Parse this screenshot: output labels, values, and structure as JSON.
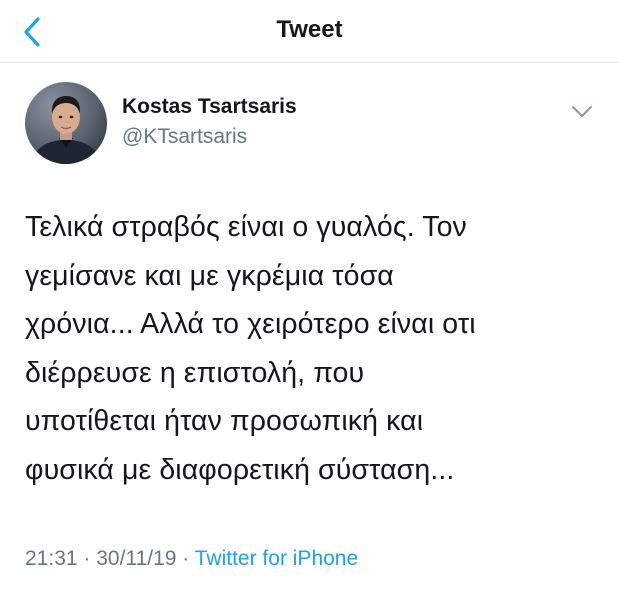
{
  "nav": {
    "title": "Tweet",
    "back_icon": "chevron-left-icon",
    "accent_color": "#1da1f2"
  },
  "tweet": {
    "author": {
      "name": "Kostas Tsartsaris",
      "handle": "@KTsartsaris",
      "avatar": "avatar-photo"
    },
    "menu_icon": "chevron-down-icon",
    "text_lines": [
      "Τελικά στραβός είναι ο γυαλός. Τον",
      "γεμίσανε και με γκρέμια τόσα",
      "χρόνια... Αλλά το χειρότερο είναι οτι",
      "διέρρευσε η επιστολή, που",
      "υποτίθεται ήταν προσωπική και",
      "φυσικά με διαφορετική σύσταση..."
    ],
    "time": "21:31",
    "separator": "·",
    "date": "30/11/19",
    "source": "Twitter for iPhone"
  }
}
